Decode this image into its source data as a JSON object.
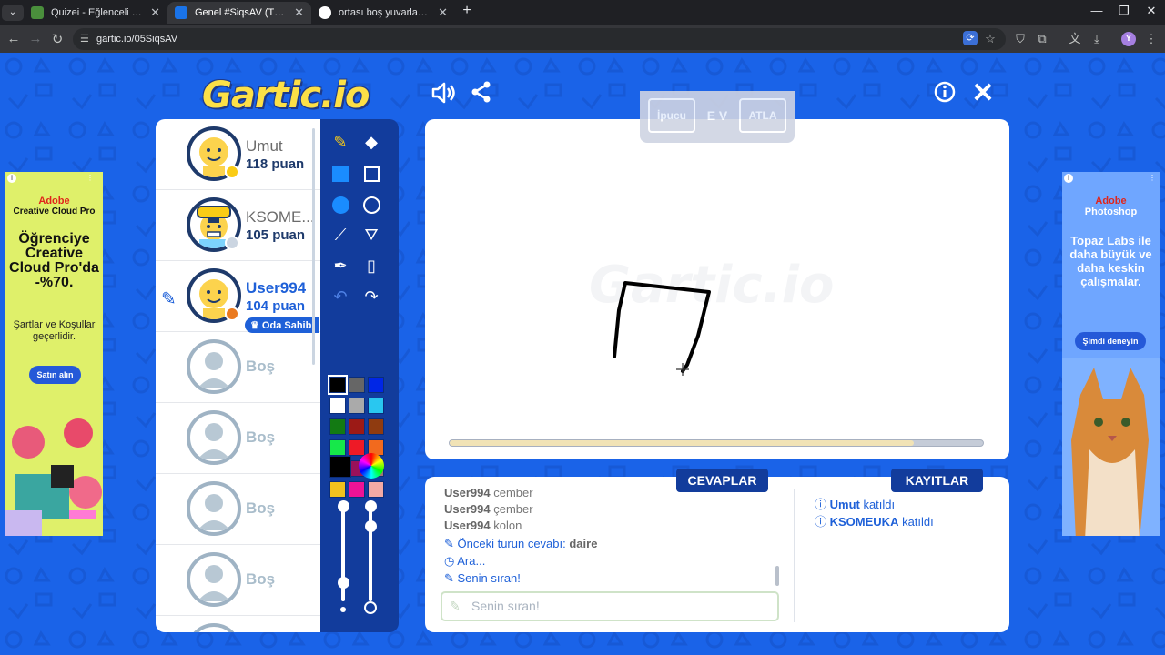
{
  "browser": {
    "tabs": [
      {
        "title": "Quizei - Eğlenceli ve etkileşimli",
        "active": false,
        "favicon_color": "#4a8f3c"
      },
      {
        "title": "Genel #SiqsAV (Türkçe) - Gartic",
        "active": true,
        "favicon_color": "#1a73e8"
      },
      {
        "title": "ortası boş yuvarlak ismi - Google",
        "active": false,
        "favicon_color": "#ffffff"
      }
    ],
    "new_tab": "+",
    "url": "gartic.io/05SiqsAV",
    "profile_initial": "Y"
  },
  "game": {
    "logo": "Gartic.io",
    "players": [
      {
        "name": "Umut",
        "points": "118 puan",
        "status_color": "#facc15",
        "hat": false
      },
      {
        "name": "KSOME...",
        "points": "105 puan",
        "status_color": "#cbd5e1",
        "hat": true
      },
      {
        "name": "User994",
        "points": "104 puan",
        "status_color": "#ea7a1f",
        "me": true,
        "owner": "Oda Sahibi"
      }
    ],
    "empty_label": "Boş",
    "empty_count": 4,
    "palette": [
      "#000000",
      "#666666",
      "#0026e6",
      "#ffffff",
      "#aaaaaa",
      "#29c7f0",
      "#137a13",
      "#9c1a16",
      "#8f3b10",
      "#16e84a",
      "#ee1a26",
      "#f26a1e",
      "#a17335",
      "#99115a",
      "#a17575",
      "#f2c21e",
      "#ee1396",
      "#f2aaa5"
    ],
    "current_color": "#000000",
    "hint": {
      "hint_label": "İpucu",
      "word": "E V",
      "skip_label": "ATLA"
    },
    "progress_fraction": 0.87,
    "tabs": {
      "answers": "CEVAPLAR",
      "logs": "KAYITLAR"
    },
    "answers": [
      {
        "user": "User994",
        "text": "cember"
      },
      {
        "user": "User994",
        "text": "çember"
      },
      {
        "user": "User994",
        "text": "kolon"
      }
    ],
    "system_messages": [
      {
        "icon": "pencil-icon",
        "text": "Önceki turun cevabı: ",
        "bold": "daire"
      },
      {
        "icon": "clock-icon",
        "text": "Ara...",
        "bold": ""
      },
      {
        "icon": "pencil-icon",
        "text": "Senin sıran!",
        "bold": ""
      }
    ],
    "logs": [
      {
        "user": "Umut",
        "text": " katıldı"
      },
      {
        "user": "KSOMEUKA",
        "text": " katıldı"
      }
    ],
    "chat_placeholder": "Senin sıran!"
  },
  "ads": {
    "left": {
      "brand": "Adobe",
      "product": "Creative Cloud Pro",
      "headline": "Öğrenciye Creative Cloud Pro'da -%70.",
      "body": "Şartlar ve Koşullar geçerlidir.",
      "cta": "Satın alın"
    },
    "right": {
      "brand": "Adobe",
      "product": "Photoshop",
      "headline": "Topaz Labs ile daha büyük ve daha keskin çalışmalar.",
      "cta": "Şimdi deneyin"
    }
  }
}
